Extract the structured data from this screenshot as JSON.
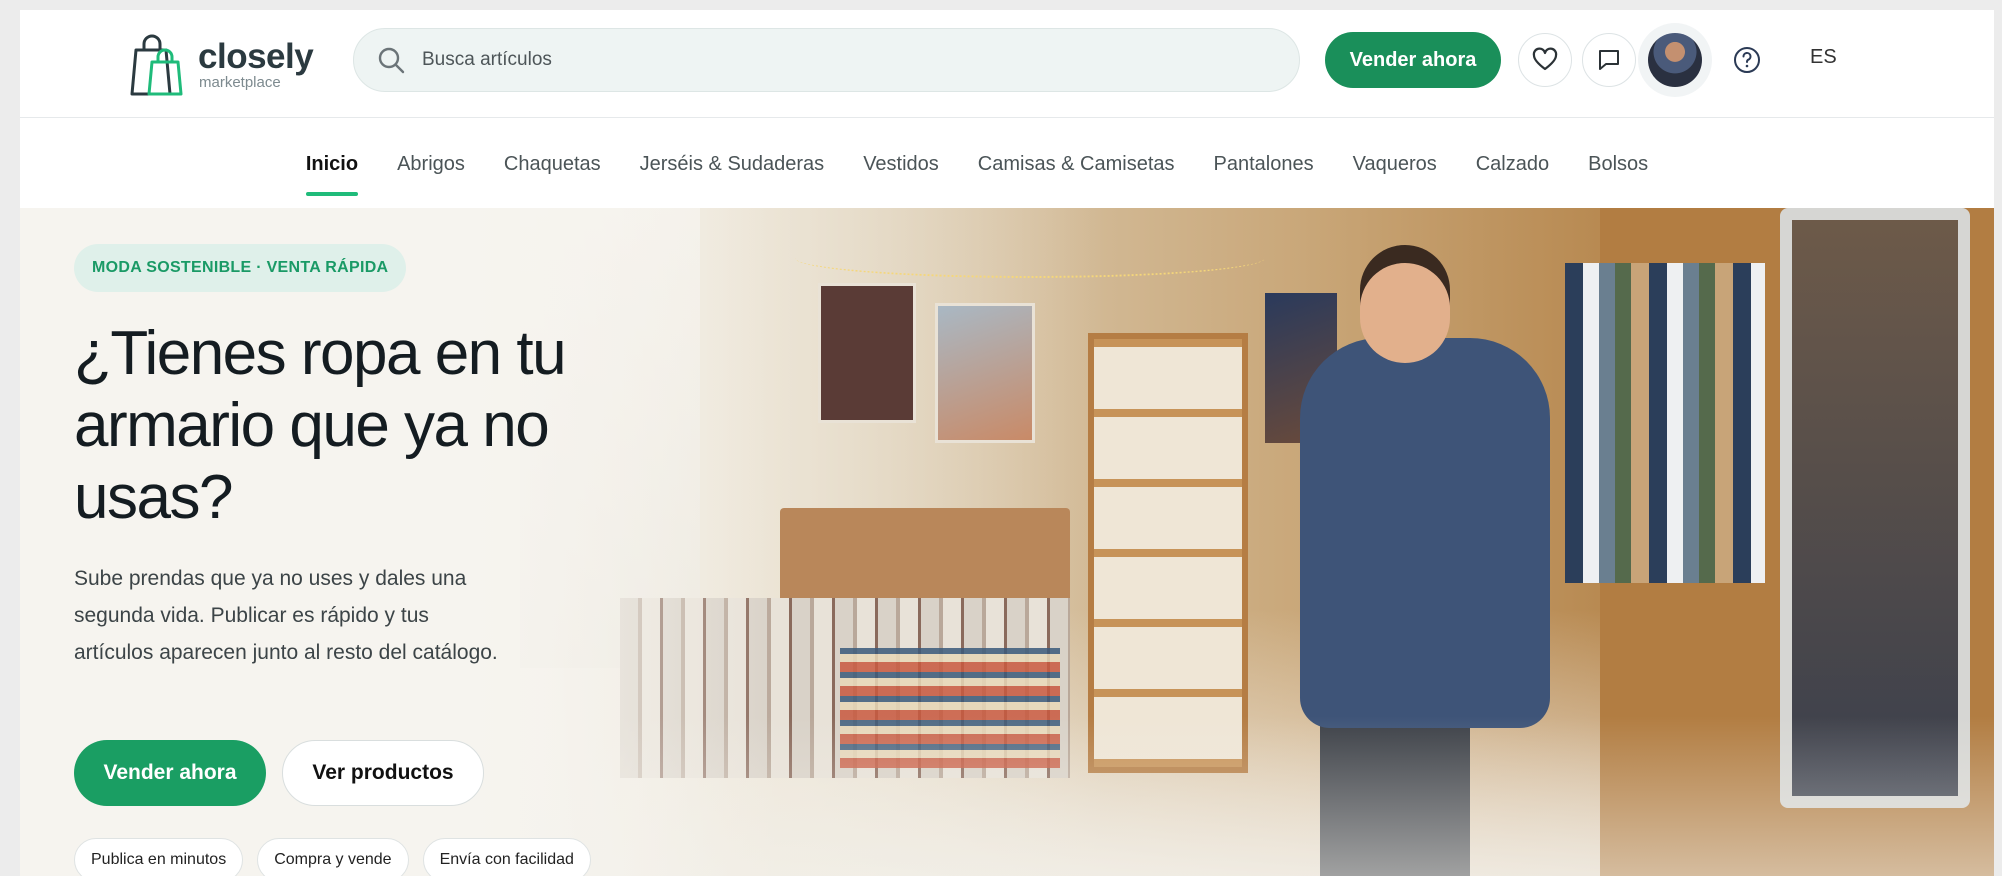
{
  "brand": {
    "name": "closely",
    "tagline": "marketplace",
    "accent": "#1a8f5a",
    "accent_light": "#1fbb7a"
  },
  "header": {
    "search_placeholder": "Busca artículos",
    "sell_label": "Vender ahora",
    "language": "ES",
    "icons": [
      "search-icon",
      "heart-icon",
      "chat-icon",
      "avatar",
      "help-icon"
    ]
  },
  "nav": {
    "items": [
      {
        "label": "Inicio",
        "active": true
      },
      {
        "label": "Abrigos"
      },
      {
        "label": "Chaquetas"
      },
      {
        "label": "Jerséis & Sudaderas"
      },
      {
        "label": "Vestidos"
      },
      {
        "label": "Camisas & Camisetas"
      },
      {
        "label": "Pantalones"
      },
      {
        "label": "Vaqueros"
      },
      {
        "label": "Calzado"
      },
      {
        "label": "Bolsos"
      }
    ]
  },
  "hero": {
    "badge": "MODA SOSTENIBLE · VENTA RÁPIDA",
    "title": "¿Tienes ropa en tu armario que ya no usas?",
    "text": "Sube prendas que ya no uses y dales una segunda vida. Publicar es rápido y tus artículos aparecen junto al resto del catálogo.",
    "primary_cta": "Vender ahora",
    "secondary_cta": "Ver productos",
    "chips": [
      "Publica en minutos",
      "Compra y vende",
      "Envía con facilidad"
    ]
  }
}
